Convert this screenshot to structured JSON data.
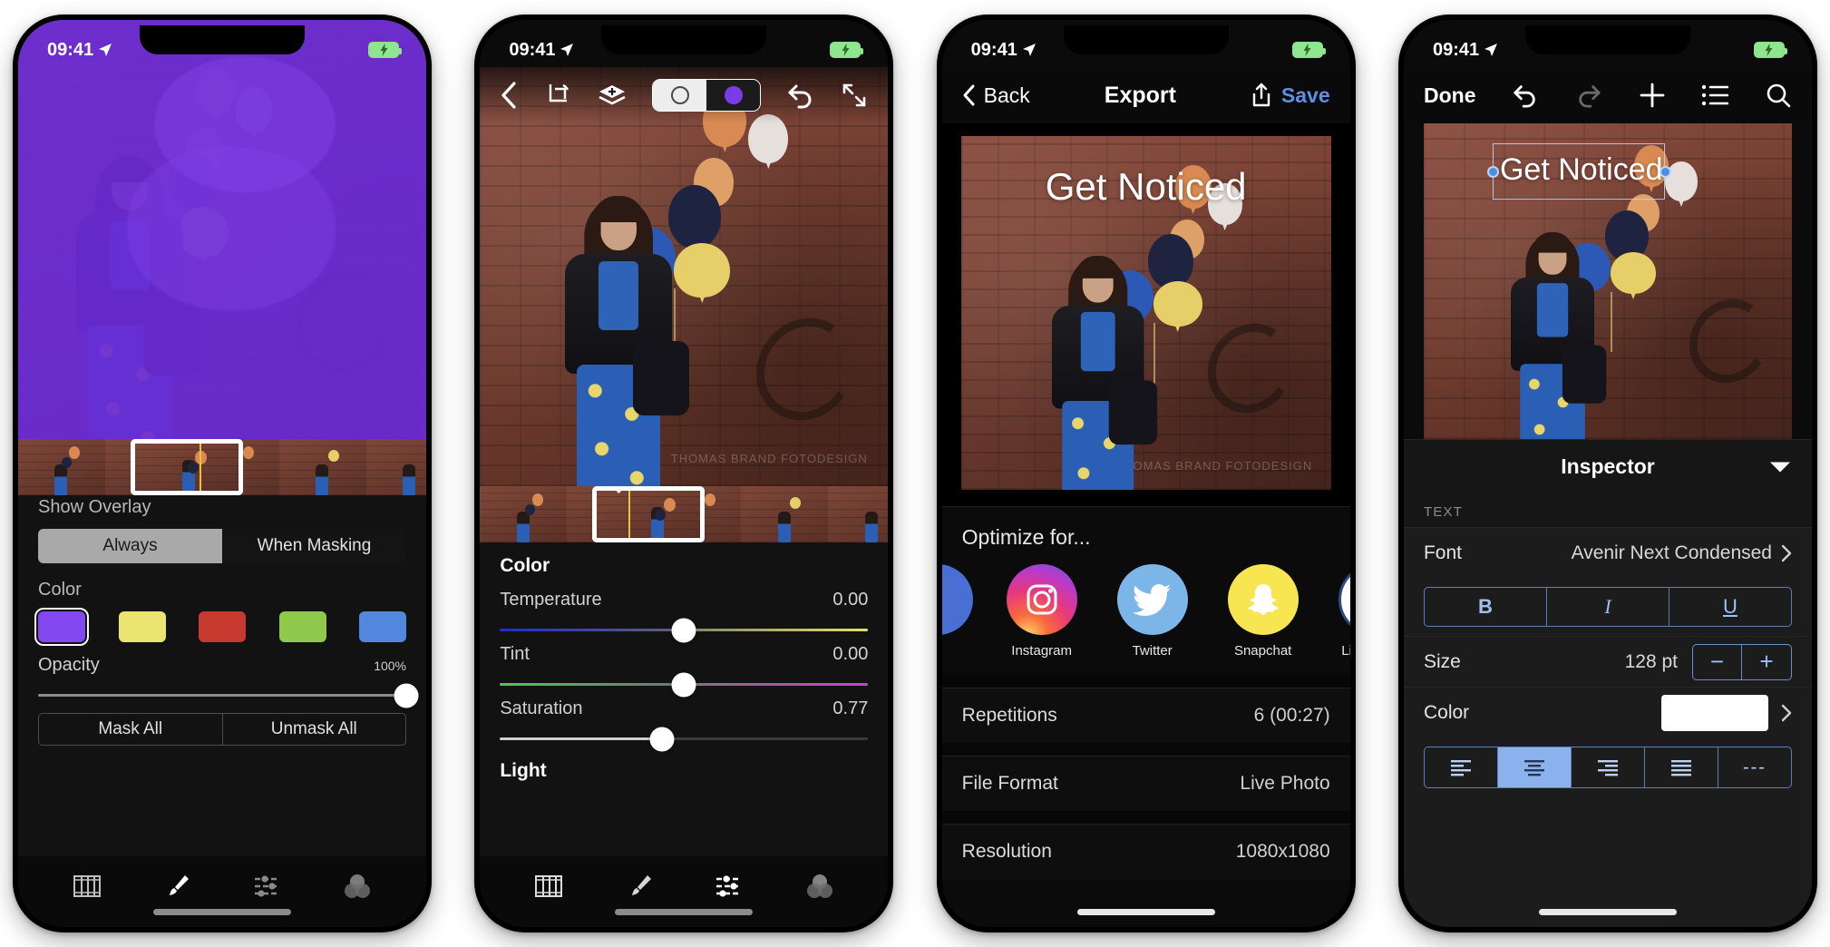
{
  "statusbar": {
    "time": "09:41",
    "location_icon": "location-arrow-icon",
    "battery_icon": "battery-charging-icon"
  },
  "screen1": {
    "name": "mask-overlay-editor",
    "overlay_color": "#6b2bd6",
    "show_overlay_label": "Show Overlay",
    "segment": {
      "options": [
        "Always",
        "When Masking"
      ],
      "selected": "Always"
    },
    "color_label": "Color",
    "swatches": [
      {
        "name": "purple",
        "hex": "#8247ef",
        "selected": true
      },
      {
        "name": "yellow",
        "hex": "#ece471",
        "selected": false
      },
      {
        "name": "red",
        "hex": "#c63a30",
        "selected": false
      },
      {
        "name": "green",
        "hex": "#8fc94b",
        "selected": false
      },
      {
        "name": "blue",
        "hex": "#5187dd",
        "selected": false
      }
    ],
    "opacity": {
      "label": "Opacity",
      "value": "100%",
      "percent": 100
    },
    "mask_all_label": "Mask All",
    "unmask_all_label": "Unmask All",
    "tabs": [
      {
        "name": "filmstrip-tab",
        "icon": "film-strip-icon",
        "active": false
      },
      {
        "name": "brush-tab",
        "icon": "paintbrush-icon",
        "active": true
      },
      {
        "name": "adjust-tab",
        "icon": "sliders-icon",
        "active": false
      },
      {
        "name": "color-tab",
        "icon": "color-circles-icon",
        "active": false
      }
    ]
  },
  "screen2": {
    "name": "color-adjust-editor",
    "toolbar": [
      {
        "name": "back-button",
        "icon": "chevron-left-icon"
      },
      {
        "name": "crop-rotate-button",
        "icon": "crop-rotate-icon"
      },
      {
        "name": "layers-button",
        "icon": "layers-add-icon"
      },
      {
        "name": "mask-toggle",
        "icon": "mask-toggle-switch"
      },
      {
        "name": "undo-button",
        "icon": "undo-icon"
      },
      {
        "name": "fullscreen-button",
        "icon": "expand-arrows-icon"
      }
    ],
    "toggle": {
      "off_icon": "circle-outline-icon",
      "on_icon": "purple-dot-icon",
      "on_color": "#7b3ce8",
      "selected": "on"
    },
    "color_section": "Color",
    "sliders": [
      {
        "name": "temperature",
        "label": "Temperature",
        "value": "0.00",
        "percent": 50,
        "track": "temp"
      },
      {
        "name": "tint",
        "label": "Tint",
        "value": "0.00",
        "percent": 50,
        "track": "tint"
      },
      {
        "name": "saturation",
        "label": "Saturation",
        "value": "0.77",
        "percent": 44,
        "track": "sat"
      }
    ],
    "light_section": "Light",
    "tabs": [
      {
        "name": "filmstrip-tab",
        "icon": "film-strip-icon",
        "active": false
      },
      {
        "name": "brush-tab",
        "icon": "paintbrush-icon",
        "active": false
      },
      {
        "name": "adjust-tab",
        "icon": "sliders-icon",
        "active": true
      },
      {
        "name": "color-tab",
        "icon": "color-circles-icon",
        "active": false
      }
    ]
  },
  "screen3": {
    "name": "export-screen",
    "nav": {
      "back_label": "Back",
      "title": "Export",
      "share_icon": "share-up-icon",
      "save_label": "Save"
    },
    "preview_text": "Get Noticed",
    "watermark": "THOMAS BRAND FOTODESIGN",
    "optimize_title": "Optimize for...",
    "socials": [
      {
        "name": "instagram",
        "label": "Instagram",
        "icon": "instagram-icon",
        "selected": false
      },
      {
        "name": "twitter",
        "label": "Twitter",
        "icon": "twitter-bird-icon",
        "selected": false
      },
      {
        "name": "snapchat",
        "label": "Snapchat",
        "icon": "snapchat-ghost-icon",
        "selected": false
      },
      {
        "name": "live-photo",
        "label": "Live Photo",
        "icon": "live-photo-icon",
        "selected": true
      }
    ],
    "rows": [
      {
        "name": "repetitions",
        "label": "Repetitions",
        "value": "6 (00:27)"
      },
      {
        "name": "file-format",
        "label": "File Format",
        "value": "Live Photo"
      },
      {
        "name": "resolution",
        "label": "Resolution",
        "value": "1080x1080"
      }
    ]
  },
  "screen4": {
    "name": "text-inspector-screen",
    "toolbar": {
      "done_label": "Done",
      "items": [
        {
          "name": "undo-button",
          "icon": "undo-icon",
          "enabled": true
        },
        {
          "name": "redo-button",
          "icon": "redo-icon",
          "enabled": false
        },
        {
          "name": "add-button",
          "icon": "plus-icon",
          "enabled": true
        },
        {
          "name": "list-button",
          "icon": "list-icon",
          "enabled": true
        },
        {
          "name": "search-button",
          "icon": "search-icon",
          "enabled": true
        }
      ]
    },
    "canvas_text": "Get Noticed",
    "inspector": {
      "title": "Inspector",
      "caret_icon": "chevron-down-icon",
      "section": "TEXT"
    },
    "font": {
      "label": "Font",
      "value": "Avenir Next Condensed",
      "chevron": "chevron-right-icon"
    },
    "style_buttons": [
      {
        "name": "bold-button",
        "label": "B"
      },
      {
        "name": "italic-button",
        "label": "I"
      },
      {
        "name": "underline-button",
        "label": "U"
      }
    ],
    "size": {
      "label": "Size",
      "value": "128 pt",
      "minus": "−",
      "plus": "+"
    },
    "color": {
      "label": "Color",
      "swatch_hex": "#ffffff",
      "chevron": "chevron-right-icon"
    },
    "alignment": {
      "options": [
        {
          "name": "align-left",
          "icon": "align-left-icon",
          "selected": false
        },
        {
          "name": "align-center",
          "icon": "align-center-icon",
          "selected": true
        },
        {
          "name": "align-right",
          "icon": "align-right-icon",
          "selected": false
        },
        {
          "name": "align-justify",
          "icon": "align-justify-icon",
          "selected": false
        },
        {
          "name": "align-none",
          "icon": "dashes-icon",
          "selected": false
        }
      ],
      "none_label": "---"
    }
  }
}
